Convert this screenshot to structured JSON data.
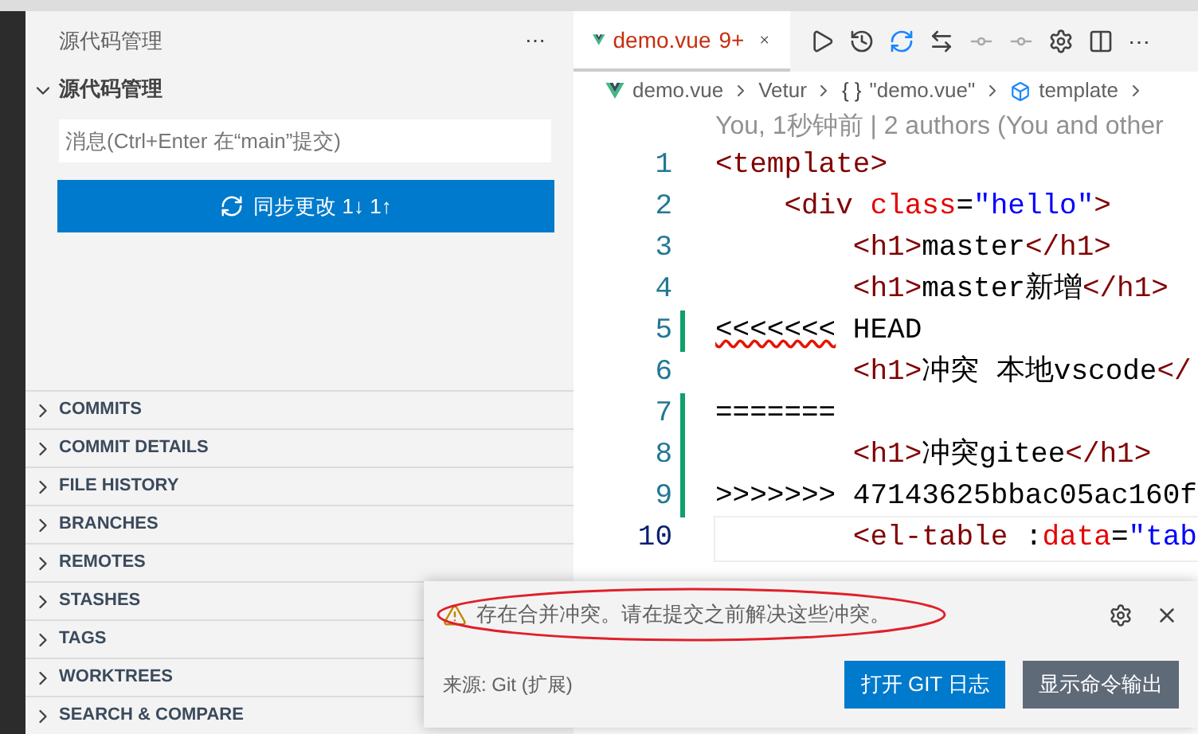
{
  "sidebar": {
    "title": "源代码管理",
    "more": "⋯",
    "section": {
      "title": "源代码管理",
      "expanded": true
    },
    "commit_message": {
      "placeholder": "消息(Ctrl+Enter 在“main”提交)"
    },
    "sync_button": "同步更改 1↓ 1↑",
    "panels": [
      {
        "label": "COMMITS",
        "expanded": false
      },
      {
        "label": "COMMIT DETAILS",
        "expanded": false
      },
      {
        "label": "FILE HISTORY",
        "expanded": false
      },
      {
        "label": "BRANCHES",
        "expanded": false
      },
      {
        "label": "REMOTES",
        "expanded": false
      },
      {
        "label": "STASHES",
        "expanded": false
      },
      {
        "label": "TAGS",
        "expanded": false
      },
      {
        "label": "WORKTREES",
        "expanded": false
      },
      {
        "label": "SEARCH & COMPARE",
        "expanded": false
      }
    ]
  },
  "editor": {
    "tab": {
      "label": "demo.vue",
      "badge": "9+",
      "selected": true
    },
    "more": "⋯",
    "breadcrumbs": [
      {
        "kind": "file",
        "label": "demo.vue"
      },
      {
        "kind": "plain",
        "label": "Vetur"
      },
      {
        "kind": "object",
        "symbol": "{ }",
        "label": "\"demo.vue\""
      },
      {
        "kind": "element",
        "label": "template"
      }
    ],
    "codelens": "You, 1秒钟前 | 2 authors (You and other",
    "lines": [
      {
        "number": "1",
        "current": false,
        "marker": false,
        "error": false,
        "tokens": [
          {
            "kind": "tag",
            "text": "<template>"
          }
        ]
      },
      {
        "number": "2",
        "current": false,
        "marker": false,
        "error": false,
        "tokens": [
          {
            "kind": "tag",
            "text": "    <div"
          },
          {
            "kind": "attr",
            "text": " class"
          },
          {
            "kind": "text",
            "text": "="
          },
          {
            "kind": "string",
            "text": "\"hello\""
          },
          {
            "kind": "tag",
            "text": ">"
          }
        ]
      },
      {
        "number": "3",
        "current": false,
        "marker": false,
        "error": false,
        "tokens": [
          {
            "kind": "tag",
            "text": "        <h1>"
          },
          {
            "kind": "text",
            "text": "master"
          },
          {
            "kind": "tag",
            "text": "</h1>"
          }
        ]
      },
      {
        "number": "4",
        "current": false,
        "marker": false,
        "error": false,
        "tokens": [
          {
            "kind": "tag",
            "text": "        <h1>"
          },
          {
            "kind": "text",
            "text": "master新增"
          },
          {
            "kind": "tag",
            "text": "</h1>"
          }
        ]
      },
      {
        "number": "5",
        "current": false,
        "marker": true,
        "error": true,
        "tokens": [
          {
            "kind": "text",
            "text": "<<<<<<<"
          },
          {
            "kind": "text",
            "text": " HEAD"
          }
        ]
      },
      {
        "number": "6",
        "current": false,
        "marker": false,
        "error": false,
        "tokens": [
          {
            "kind": "tag",
            "text": "        <h1>"
          },
          {
            "kind": "text",
            "text": "冲突 本地vscode"
          },
          {
            "kind": "tag",
            "text": "</"
          }
        ]
      },
      {
        "number": "7",
        "current": false,
        "marker": true,
        "error": false,
        "tokens": [
          {
            "kind": "text",
            "text": "======="
          }
        ]
      },
      {
        "number": "8",
        "current": false,
        "marker": true,
        "error": false,
        "tokens": [
          {
            "kind": "tag",
            "text": "        <h1>"
          },
          {
            "kind": "text",
            "text": "冲突gitee"
          },
          {
            "kind": "tag",
            "text": "</h1>"
          }
        ]
      },
      {
        "number": "9",
        "current": false,
        "marker": true,
        "error": false,
        "tokens": [
          {
            "kind": "text",
            "text": ">>>>>>> 47143625bbac05ac160f"
          }
        ]
      },
      {
        "number": "10",
        "current": true,
        "marker": false,
        "error": false,
        "tokens": [
          {
            "kind": "tag",
            "text": "        <el-table"
          },
          {
            "kind": "text",
            "text": " :"
          },
          {
            "kind": "attr",
            "text": "data"
          },
          {
            "kind": "text",
            "text": "="
          },
          {
            "kind": "string",
            "text": "\"tab"
          }
        ]
      }
    ]
  },
  "notification": {
    "message": "存在合并冲突。请在提交之前解决这些冲突。",
    "source": "来源: Git (扩展)",
    "buttons": [
      {
        "label": "打开 GIT 日志",
        "kind": "primary"
      },
      {
        "label": "显示命令输出",
        "kind": "secondary"
      }
    ]
  }
}
